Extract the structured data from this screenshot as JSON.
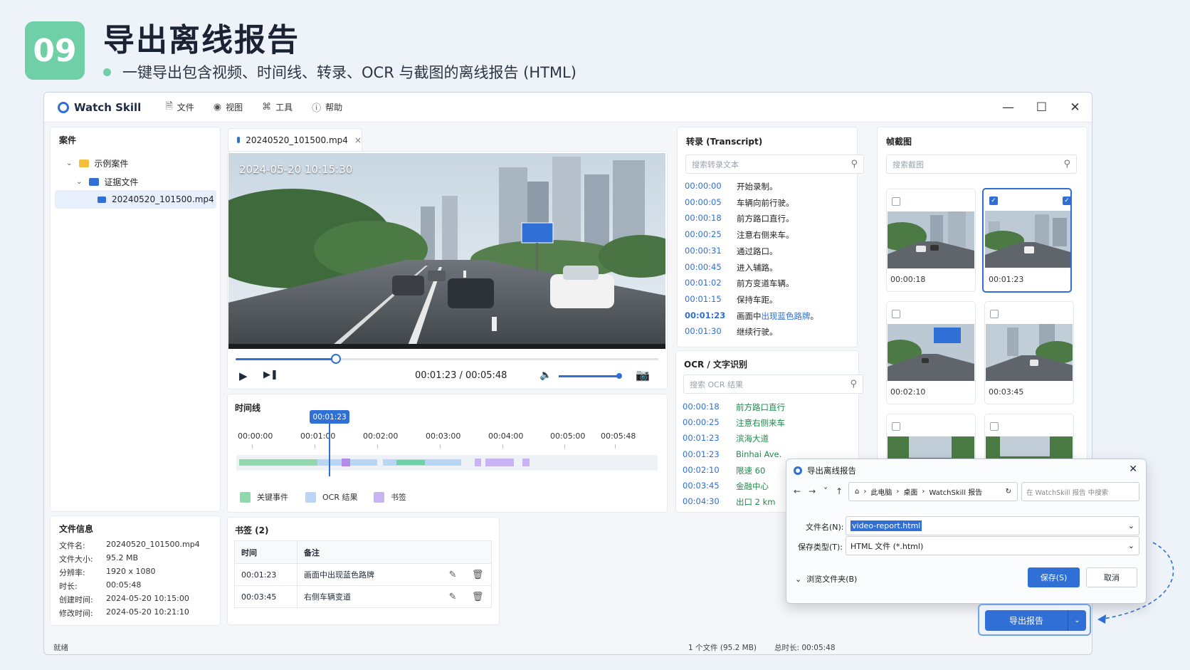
{
  "slide": {
    "number": "09",
    "title": "导出离线报告",
    "subtitle": "一键导出包含视频、时间线、转录、OCR 与截图的离线报告 (HTML)"
  },
  "app": {
    "name": "Watch Skill",
    "menu": [
      {
        "label": "文件",
        "icon": "file-icon"
      },
      {
        "label": "视图",
        "icon": "eye-icon"
      },
      {
        "label": "工具",
        "icon": "tools-icon"
      },
      {
        "label": "帮助",
        "icon": "help-icon"
      }
    ],
    "window_controls": [
      "minimize-icon",
      "maximize-icon",
      "close-icon"
    ]
  },
  "case_panel": {
    "title": "案件",
    "tree": [
      {
        "label": "示例案件",
        "level": 0,
        "type": "folder"
      },
      {
        "label": "证据文件",
        "level": 1,
        "type": "folder"
      },
      {
        "label": "20240520_101500.mp4",
        "level": 2,
        "type": "video",
        "selected": true
      }
    ]
  },
  "file_info": {
    "title": "文件信息",
    "rows": [
      {
        "key": "文件名:",
        "value": "20240520_101500.mp4"
      },
      {
        "key": "文件大小:",
        "value": "95.2 MB"
      },
      {
        "key": "分辨率:",
        "value": "1920 x 1080"
      },
      {
        "key": "时长:",
        "value": "00:05:48"
      },
      {
        "key": "创建时间:",
        "value": "2024-05-20 10:15:00"
      },
      {
        "key": "修改时间:",
        "value": "2024-05-20 10:21:10"
      }
    ]
  },
  "video": {
    "tab_label": "20240520_101500.mp4",
    "overlay_timestamp": "2024-05-20 10:15:30",
    "time_display": "00:01:23 / 00:05:48",
    "progress": 0.238,
    "volume": 1.0
  },
  "timeline": {
    "title": "时间线",
    "current_label": "00:01:23",
    "ticks": [
      "00:00:00",
      "00:01:00",
      "00:02:00",
      "00:03:00",
      "00:04:00",
      "00:05:00",
      "00:05:48"
    ],
    "legend": [
      {
        "label": "关键事件",
        "color": "#8fd9ac"
      },
      {
        "label": "OCR 结果",
        "color": "#b9d6f7"
      },
      {
        "label": "书签",
        "color": "#c9b3f2"
      }
    ]
  },
  "bookmarks": {
    "title": "书签 (2)",
    "headers": [
      "时间",
      "备注"
    ],
    "rows": [
      {
        "time": "00:01:23",
        "note": "画面中出现蓝色路牌"
      },
      {
        "time": "00:03:45",
        "note": "右侧车辆变道"
      }
    ]
  },
  "transcript": {
    "title": "转录 (Transcript)",
    "search_placeholder": "搜索转录文本",
    "rows": [
      {
        "time": "00:00:00",
        "text": "开始录制。"
      },
      {
        "time": "00:00:05",
        "text": "车辆向前行驶。"
      },
      {
        "time": "00:00:18",
        "text": "前方路口直行。"
      },
      {
        "time": "00:00:25",
        "text": "注意右侧来车。"
      },
      {
        "time": "00:00:31",
        "text": "通过路口。"
      },
      {
        "time": "00:00:45",
        "text": "进入辅路。"
      },
      {
        "time": "00:01:02",
        "text": "前方变道车辆。"
      },
      {
        "time": "00:01:15",
        "text": "保持车距。"
      },
      {
        "time": "00:01:23",
        "text_prefix": "画面中",
        "text_highlight": "出现蓝色路牌",
        "text_suffix": "。",
        "active": true
      },
      {
        "time": "00:01:30",
        "text": "继续行驶。"
      }
    ]
  },
  "ocr": {
    "title": "OCR / 文字识别",
    "search_placeholder": "搜索 OCR 结果",
    "rows": [
      {
        "time": "00:00:18",
        "text": "前方路口直行"
      },
      {
        "time": "00:00:25",
        "text": "注意右侧来车"
      },
      {
        "time": "00:01:23",
        "text": "滨海大道"
      },
      {
        "time": "00:01:23",
        "text": "Binhai Ave."
      },
      {
        "time": "00:02:10",
        "text": "限速 60"
      },
      {
        "time": "00:03:45",
        "text": "金融中心"
      },
      {
        "time": "00:04:30",
        "text": "出口 2 km"
      }
    ]
  },
  "frames": {
    "title": "帧截图",
    "search_placeholder": "搜索截图",
    "items": [
      {
        "time": "00:00:18",
        "checked": false
      },
      {
        "time": "00:01:23",
        "checked": true
      },
      {
        "time": "00:02:10",
        "checked": false
      },
      {
        "time": "00:03:45",
        "checked": false
      },
      {
        "time": "",
        "checked": false
      },
      {
        "time": "",
        "checked": false
      }
    ]
  },
  "status_bar": {
    "left": "就绪",
    "files": "1 个文件 (95.2 MB)",
    "duration": "总时长: 00:05:48"
  },
  "save_dialog": {
    "title": "导出离线报告",
    "breadcrumb": [
      "此电脑",
      "桌面",
      "WatchSkill 报告"
    ],
    "search_placeholder": "在 WatchSkill 报告 中搜索",
    "filename_label": "文件名(N):",
    "filename_value": "video-report.html",
    "filetype_label": "保存类型(T):",
    "filetype_value": "HTML 文件 (*.html)",
    "browse_label": "浏览文件夹(B)",
    "save_label": "保存(S)",
    "cancel_label": "取消"
  },
  "export_button": {
    "label": "导出报告"
  }
}
